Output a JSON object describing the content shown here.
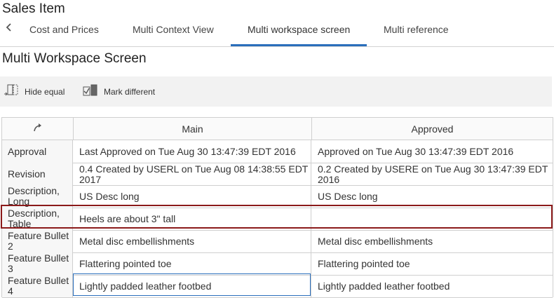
{
  "page": {
    "title": "Sales Item",
    "subtitle": "Multi Workspace Screen"
  },
  "tabs": [
    {
      "label": "Cost and Prices",
      "active": false
    },
    {
      "label": "Multi Context View",
      "active": false
    },
    {
      "label": "Multi workspace screen",
      "active": true
    },
    {
      "label": "Multi reference",
      "active": false
    }
  ],
  "toolbar": {
    "hide_equal_label": "Hide equal",
    "mark_different_label": "Mark different"
  },
  "grid": {
    "columns": {
      "main": "Main",
      "approved": "Approved"
    },
    "rows": [
      {
        "label": "Approval",
        "main": "Last Approved on Tue Aug 30 13:47:39 EDT 2016",
        "approved": "Approved on Tue Aug 30 13:47:39 EDT 2016"
      },
      {
        "label": "Revision",
        "main": "0.4 Created by USERL on Tue Aug 08 14:38:55 EDT 2017",
        "approved": "0.2 Created by USERE on Tue Aug 30 13:47:39 EDT 2016"
      },
      {
        "label": "Description, Long",
        "main": "US Desc long",
        "approved": "US Desc long"
      },
      {
        "label": "Description, Table",
        "main": "Heels are about 3\" tall",
        "approved": ""
      },
      {
        "label": "Feature Bullet 2",
        "main": "Metal disc embellishments",
        "approved": "Metal disc embellishments"
      },
      {
        "label": "Feature Bullet 3",
        "main": "Flattering pointed toe",
        "approved": "Flattering pointed toe"
      },
      {
        "label": "Feature Bullet 4",
        "main": "Lightly padded leather footbed",
        "approved": "Lightly padded leather footbed"
      }
    ],
    "highlighted_row_label": "Description, Table",
    "focused_cell": "Feature Bullet 4 / Main"
  },
  "icons": {
    "back": "chevron-left-icon",
    "hide_equal": "hide-equal-icon",
    "mark_different": "mark-different-icon",
    "corner": "swap-arrow-icon"
  },
  "colors": {
    "accent": "#2a6ebb",
    "highlight_border": "#8b1a1a",
    "toolbar_bg": "#f2f2f2"
  }
}
